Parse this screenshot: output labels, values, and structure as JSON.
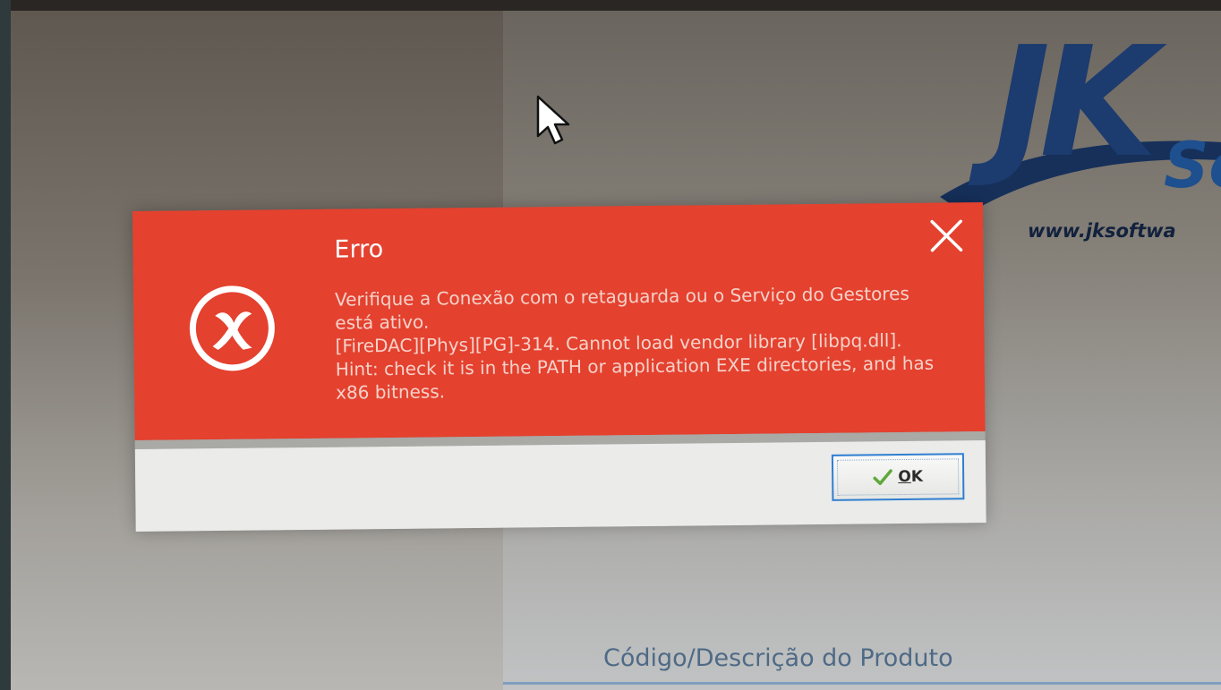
{
  "background": {
    "logo": {
      "mark": "JK",
      "suffix": "So",
      "url": "www.jksoftwa"
    },
    "field_label": "Código/Descrição do Produto"
  },
  "dialog": {
    "title": "Erro",
    "icon": "error-x-circle-icon",
    "close_icon": "close-x-icon",
    "message_lines": [
      "Verifique a Conexão com o retaguarda ou o Serviço do Gestores está ativo.",
      "[FireDAC][Phys][PG]-314. Cannot load vendor library [libpq.dll]. Hint: check it is in the PATH or application EXE directories, and has x86 bitness."
    ],
    "ok_button": {
      "mnemonic": "O",
      "rest": "K",
      "icon": "checkmark-icon"
    },
    "colors": {
      "body": "#e4412f",
      "footer": "#ebebea",
      "button_focus_border": "#2f7fd1"
    }
  }
}
